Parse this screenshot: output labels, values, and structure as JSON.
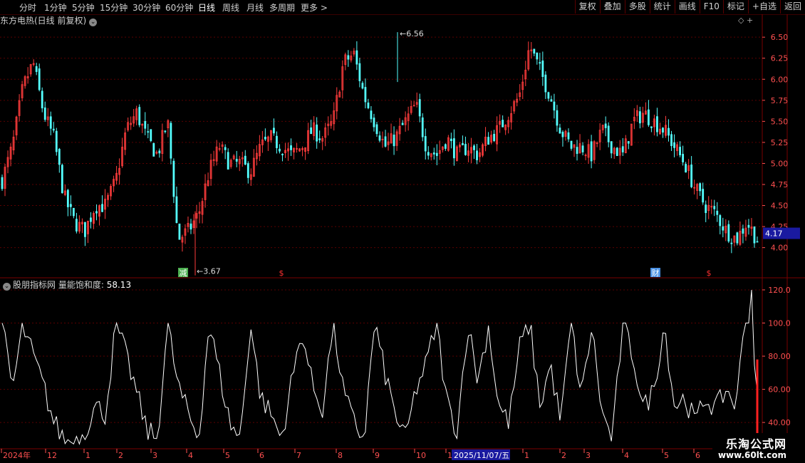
{
  "toolbar": {
    "periods": [
      {
        "label": "分时"
      },
      {
        "label": "1分钟"
      },
      {
        "label": "5分钟"
      },
      {
        "label": "15分钟"
      },
      {
        "label": "30分钟"
      },
      {
        "label": "60分钟"
      },
      {
        "label": "日线"
      },
      {
        "label": "周线"
      },
      {
        "label": "月线"
      },
      {
        "label": "多周期"
      },
      {
        "label": "更多 >"
      }
    ],
    "active_period": "日线",
    "right_buttons": [
      {
        "label": "复权"
      },
      {
        "label": "叠加"
      },
      {
        "label": "多股"
      },
      {
        "label": "统计"
      },
      {
        "label": "画线"
      },
      {
        "label": "F10"
      },
      {
        "label": "标记"
      },
      {
        "label": "+自选"
      },
      {
        "label": "返回"
      }
    ]
  },
  "main_panel": {
    "title": "东方电热(日线 前复权)",
    "current_price": "4.17",
    "high_annotation": "6.56",
    "low_annotation": "3.67",
    "markers": [
      {
        "text": "减",
        "color": "#4caf50"
      },
      {
        "text": "$",
        "color": "#ff3030"
      },
      {
        "text": "财",
        "color": "#4a90e2"
      },
      {
        "text": "$",
        "color": "#ff3030"
      }
    ]
  },
  "indicator_panel": {
    "title": "股朋指标网",
    "indicator_name": "量能饱和度",
    "indicator_value": "58.13",
    "y_ticks": [
      "120.0",
      "100.0",
      "80.00",
      "60.00",
      "40.00"
    ]
  },
  "time_axis": {
    "labels": [
      "2024年",
      "12",
      "1",
      "2",
      "3",
      "4",
      "5",
      "6",
      "7",
      "8",
      "9",
      "10",
      "11",
      "1",
      "2",
      "3",
      "4",
      "5",
      "6"
    ],
    "cursor_date": "2025/11/07/五"
  },
  "brand": {
    "name": "乐淘公式网",
    "url": "www.60lt.com"
  },
  "colors": {
    "up": "#ff3c3c",
    "down": "#54ffff",
    "axis": "#7a0000",
    "grid": "#5a0000",
    "line": "#ffffff",
    "label": "#ff5050",
    "cursor_bg": "#1a1aa0"
  },
  "chart_data": [
    {
      "type": "candlestick",
      "title": "东方电热(日线 前复权)",
      "y_ticks": [
        6.5,
        6.25,
        6.0,
        5.75,
        5.5,
        5.25,
        5.0,
        4.75,
        4.5,
        4.25,
        4.0
      ],
      "ylim": [
        3.65,
        6.62
      ],
      "high": 6.56,
      "low": 3.67,
      "last": 4.17,
      "anchors_close": [
        4.8,
        5.2,
        5.9,
        6.2,
        5.6,
        5.3,
        4.6,
        4.3,
        4.2,
        4.5,
        4.5,
        4.8,
        5.4,
        5.6,
        5.3,
        5.1,
        5.5,
        4.1,
        4.2,
        4.4,
        4.9,
        5.2,
        5.0,
        5.0,
        4.9,
        5.2,
        5.3,
        5.2,
        5.1,
        5.2,
        5.4,
        5.3,
        5.5,
        6.2,
        6.3,
        5.8,
        5.5,
        5.2,
        5.3,
        5.5,
        5.7,
        5.2,
        5.1,
        5.3,
        5.1,
        5.2,
        5.1,
        5.3,
        5.4,
        5.6,
        5.8,
        6.4,
        6.1,
        5.8,
        5.4,
        5.2,
        5.2,
        5.1,
        5.4,
        5.2,
        5.1,
        5.5,
        5.6,
        5.5,
        5.4,
        5.2,
        5.0,
        4.7,
        4.5,
        4.4,
        4.2,
        4.1,
        4.3,
        4.1
      ]
    },
    {
      "type": "line",
      "title": "股朋指标网 量能饱和度",
      "y_ticks": [
        120,
        100,
        80,
        60,
        40
      ],
      "ylim": [
        25,
        126
      ],
      "last_value": 58.13,
      "peak": 120,
      "anchors": [
        100,
        60,
        98,
        80,
        62,
        40,
        30,
        28,
        35,
        50,
        45,
        100,
        80,
        58,
        35,
        30,
        100,
        62,
        45,
        30,
        100,
        70,
        40,
        30,
        100,
        55,
        45,
        30,
        65,
        95,
        62,
        48,
        100,
        58,
        40,
        30,
        100,
        70,
        45,
        30,
        60,
        75,
        100,
        52,
        35,
        100,
        65,
        98,
        50,
        40,
        85,
        100,
        50,
        75,
        40,
        100,
        55,
        98,
        45,
        30,
        100,
        80,
        48,
        60,
        100,
        50,
        55,
        40,
        55,
        48,
        60,
        50,
        120,
        62
      ]
    }
  ]
}
